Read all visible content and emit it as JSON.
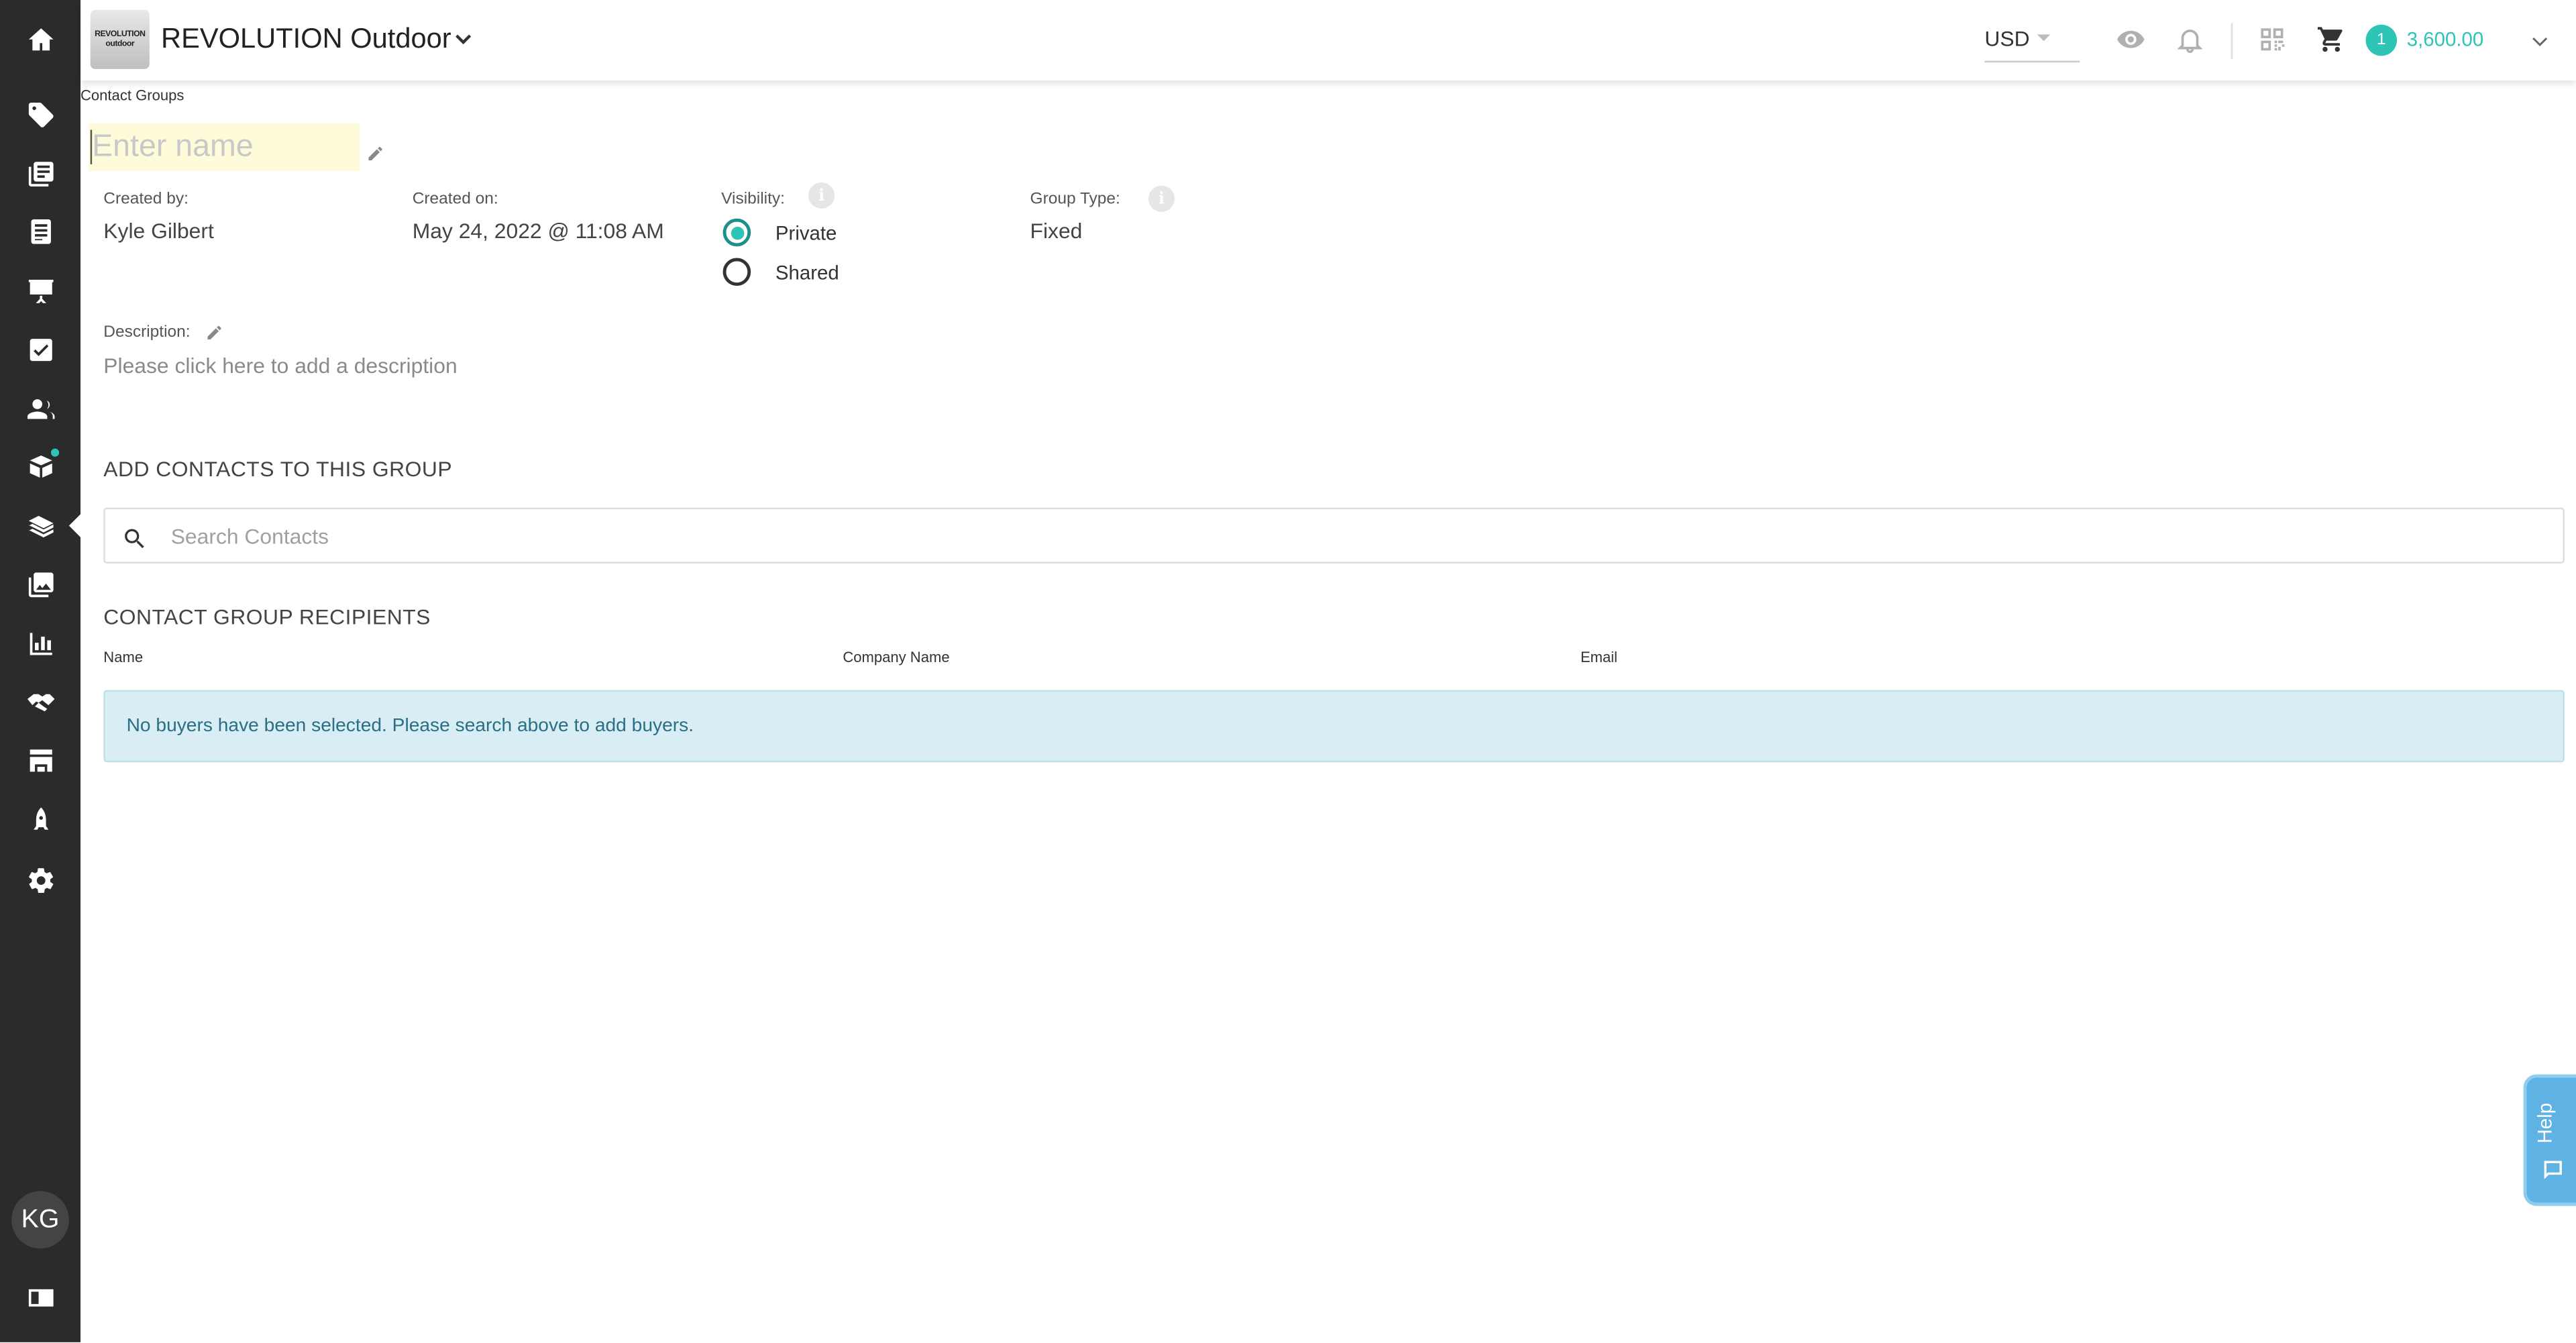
{
  "app": {
    "company_name": "REVOLUTION Outdoor",
    "logo_line1": "REVOLUTION",
    "logo_line2": "outdoor",
    "currency": "USD",
    "cart_count": "1",
    "cart_total": "3,600.00",
    "user_initials": "KG",
    "accent_color": "#2ec4b6"
  },
  "sidebar": {
    "items": [
      {
        "icon": "home-icon"
      },
      {
        "icon": "tag-icon"
      },
      {
        "icon": "catalog-icon"
      },
      {
        "icon": "line-sheet-icon"
      },
      {
        "icon": "presentation-icon"
      },
      {
        "icon": "checklist-icon"
      },
      {
        "icon": "contacts-icon"
      },
      {
        "icon": "orders-icon"
      },
      {
        "icon": "marketing-icon"
      },
      {
        "icon": "media-icon"
      },
      {
        "icon": "reports-icon"
      },
      {
        "icon": "handshake-icon"
      },
      {
        "icon": "storefront-icon"
      },
      {
        "icon": "rocket-icon"
      },
      {
        "icon": "settings-icon"
      },
      {
        "icon": "id-card-icon"
      }
    ]
  },
  "breadcrumb": "Contact Groups",
  "group": {
    "name_value": "",
    "name_placeholder": "Enter name",
    "created_by_label": "Created by:",
    "created_by": "Kyle Gilbert",
    "created_on_label": "Created on:",
    "created_on": "May 24, 2022 @ 11:08 AM",
    "visibility_label": "Visibility:",
    "visibility_options": [
      "Private",
      "Shared"
    ],
    "visibility_selected": "Private",
    "group_type_label": "Group Type:",
    "group_type": "Fixed",
    "info_glyph": "i",
    "description_label": "Description:",
    "description_placeholder": "Please click here to add a description"
  },
  "add_contacts": {
    "title": "ADD CONTACTS TO THIS GROUP",
    "search_placeholder": "Search Contacts",
    "search_value": ""
  },
  "recipients": {
    "title": "CONTACT GROUP RECIPIENTS",
    "columns": [
      "Name",
      "Company Name",
      "Email"
    ],
    "rows": [],
    "empty_message": "No buyers have been selected. Please search above to add buyers."
  },
  "help": {
    "label": "Help"
  }
}
